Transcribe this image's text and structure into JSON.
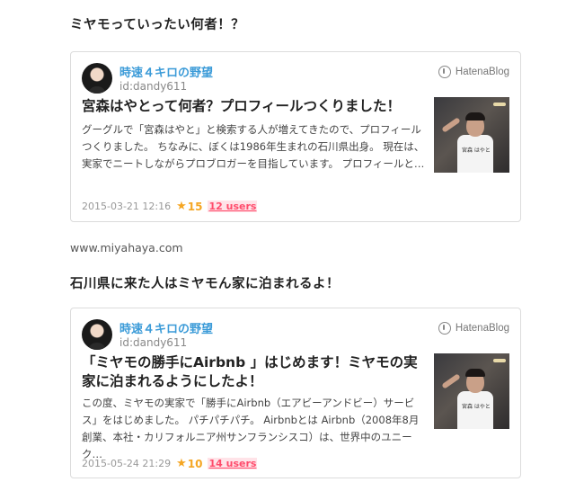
{
  "sections": [
    {
      "heading": "ミヤモっていったい何者！？",
      "card": {
        "blog_name": "時速４キロの野望",
        "blog_id": "id:dandy611",
        "logo_text": "HatenaBlog",
        "title": "宮森はやとって何者？プロフィールつくりました！",
        "description": "グーグルで「宮森はやと」と検索する人が増えてきたので、プロフィールつくりました。 ちなみに、ぼくは1986年生まれの石川県出身。 現在は、実家でニートしながらプロブロガーを目指しています。 プロフィールと…",
        "thumb_text": "宮森 はやと",
        "date": "2015-03-21 12:16",
        "stars": "15",
        "users": "12 users"
      }
    },
    {
      "heading": "石川県に来た人はミヤモん家に泊まれるよ！",
      "card": {
        "blog_name": "時速４キロの野望",
        "blog_id": "id:dandy611",
        "logo_text": "HatenaBlog",
        "title": "「ミヤモの勝手にAirbnb 」はじめます！ミヤモの実家に泊まれるようにしたよ！",
        "description": "この度、ミヤモの実家で「勝手にAirbnb（エアビーアンドビー）サービス」をはじめました。 パチパチパチ。 Airbnbとは Airbnb（2008年8月創業、本社・カリフォルニア州サンフランシスコ）は、世界中のユニーク…",
        "thumb_text": "宮森 はやと",
        "date": "2015-05-24 21:29",
        "stars": "10",
        "users": "14 users"
      }
    }
  ],
  "link_text": "www.miyahaya.com",
  "icons": {
    "logo": "hatena-blog-icon",
    "star": "star-icon"
  },
  "colors": {
    "blog_name": "#3b9bd8",
    "star": "#f5a623",
    "users": "#ff4b6b"
  }
}
